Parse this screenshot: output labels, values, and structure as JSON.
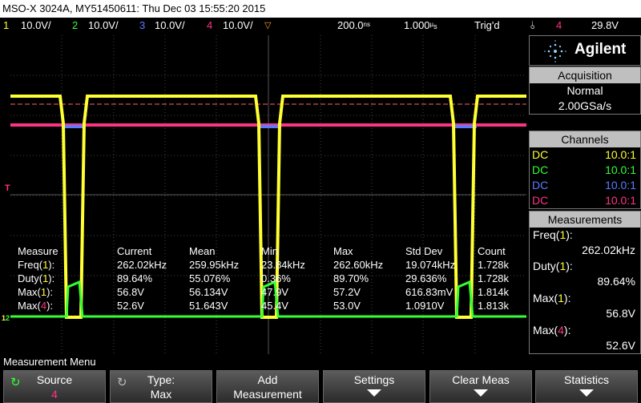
{
  "title": "MSO-X 3024A, MY51450611: Thu Dec 03 15:55:20 2015",
  "channels_header": [
    {
      "num": "1",
      "scale": "10.0V/",
      "color": "#ffff33"
    },
    {
      "num": "2",
      "scale": "10.0V/",
      "color": "#33ff33"
    },
    {
      "num": "3",
      "scale": "10.0V/",
      "color": "#5b7bff"
    },
    {
      "num": "4",
      "scale": "10.0V/",
      "color": "#ff3385"
    }
  ],
  "timebase": "200.0",
  "timebase_unit": "s",
  "timebase_prefix": "ns",
  "delay": "1.000",
  "delay_unit": "s",
  "trigger_status": "Trig'd",
  "trigger_source": "4",
  "trigger_level": "29.8V",
  "brand": "Agilent",
  "acquisition": {
    "header": "Acquisition",
    "mode": "Normal",
    "rate": "2.00GSa/s"
  },
  "channels_panel": {
    "header": "Channels",
    "rows": [
      {
        "coupling": "DC",
        "probe": "10.0:1",
        "color": "#ffff33"
      },
      {
        "coupling": "DC",
        "probe": "10.0:1",
        "color": "#33ff33"
      },
      {
        "coupling": "DC",
        "probe": "10.0:1",
        "color": "#5b7bff"
      },
      {
        "coupling": "DC",
        "probe": "10.0:1",
        "color": "#ff3385"
      }
    ]
  },
  "measurements_panel": {
    "header": "Measurements",
    "items": [
      {
        "label": "Freq(",
        "ch": "1",
        "close": "):",
        "value": "262.02kHz",
        "ch_color": "#ffff33"
      },
      {
        "label": "Duty(",
        "ch": "1",
        "close": "):",
        "value": "89.64%",
        "ch_color": "#ffff33"
      },
      {
        "label": "Max(",
        "ch": "1",
        "close": "):",
        "value": "56.8V",
        "ch_color": "#ffff33"
      },
      {
        "label": "Max(",
        "ch": "4",
        "close": "):",
        "value": "52.6V",
        "ch_color": "#ff3385"
      }
    ]
  },
  "measure_table": {
    "headers": [
      "Measure",
      "Current",
      "Mean",
      "Min",
      "Max",
      "Std Dev",
      "Count"
    ],
    "rows": [
      {
        "name": "Freq(",
        "ch": "1",
        "close": "):",
        "ch_color": "#ffff33",
        "cells": [
          "262.02kHz",
          "259.95kHz",
          "23.84kHz",
          "262.60kHz",
          "19.074kHz",
          "1.728k"
        ]
      },
      {
        "name": "Duty(",
        "ch": "1",
        "close": "):",
        "ch_color": "#ffff33",
        "cells": [
          "89.64%",
          "55.076%",
          "0.36%",
          "89.70%",
          "29.636%",
          "1.728k"
        ]
      },
      {
        "name": "Max(",
        "ch": "1",
        "close": "):",
        "ch_color": "#ffff33",
        "cells": [
          "56.8V",
          "56.134V",
          "47.9V",
          "57.2V",
          "616.83mV",
          "1.814k"
        ]
      },
      {
        "name": "Max(",
        "ch": "4",
        "close": "):",
        "ch_color": "#ff3385",
        "cells": [
          "52.6V",
          "51.643V",
          "45.4V",
          "53.0V",
          "1.0910V",
          "1.813k"
        ]
      }
    ]
  },
  "menu_title": "Measurement Menu",
  "softkeys": [
    {
      "line1": "Source",
      "line2": "4",
      "has_arrow": false
    },
    {
      "line1": "Type:",
      "line2": "Max",
      "has_arrow": false
    },
    {
      "line1": "Add",
      "line2": "Measurement",
      "has_arrow": false
    },
    {
      "line1": "Settings",
      "line2": "",
      "has_arrow": true
    },
    {
      "line1": "Clear Meas",
      "line2": "",
      "has_arrow": true
    },
    {
      "line1": "Statistics",
      "line2": "",
      "has_arrow": true
    }
  ],
  "markers": {
    "trigger": "T",
    "ch1": "1",
    "ch2": "2"
  }
}
